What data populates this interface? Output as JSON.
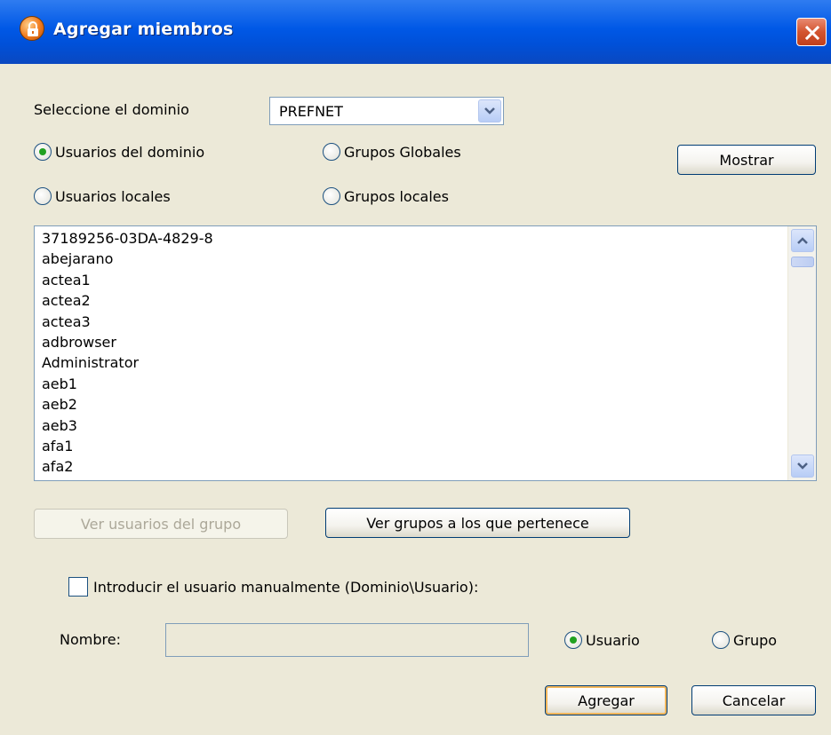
{
  "window": {
    "title": "Agregar miembros",
    "close_glyph": "✕"
  },
  "domain": {
    "label": "Seleccione el dominio",
    "selected": "PREFNET"
  },
  "filters": {
    "domain_users": "Usuarios del dominio",
    "global_groups": "Grupos Globales",
    "local_users": "Usuarios locales",
    "local_groups": "Grupos locales",
    "selected": "domain_users"
  },
  "buttons": {
    "show": "Mostrar",
    "view_group_users": "Ver usuarios del grupo",
    "view_member_groups": "Ver grupos a los que pertenece",
    "add": "Agregar",
    "cancel": "Cancelar"
  },
  "list": {
    "items": [
      "37189256-03DA-4829-8",
      "abejarano",
      "actea1",
      "actea2",
      "actea3",
      "adbrowser",
      "Administrator",
      "aeb1",
      "aeb2",
      "aeb3",
      "afa1",
      "afa2"
    ]
  },
  "manual": {
    "checkbox_label": "Introducir el usuario manualmente (Dominio\\Usuario):",
    "checked": false,
    "name_label": "Nombre:",
    "name_value": "",
    "type_user": "Usuario",
    "type_group": "Grupo",
    "type_selected": "user"
  },
  "colors": {
    "titlebar": "#0058e6",
    "dialog_bg": "#ece9d8",
    "radio_selected": "#21a121",
    "close_button": "#d3542f"
  }
}
